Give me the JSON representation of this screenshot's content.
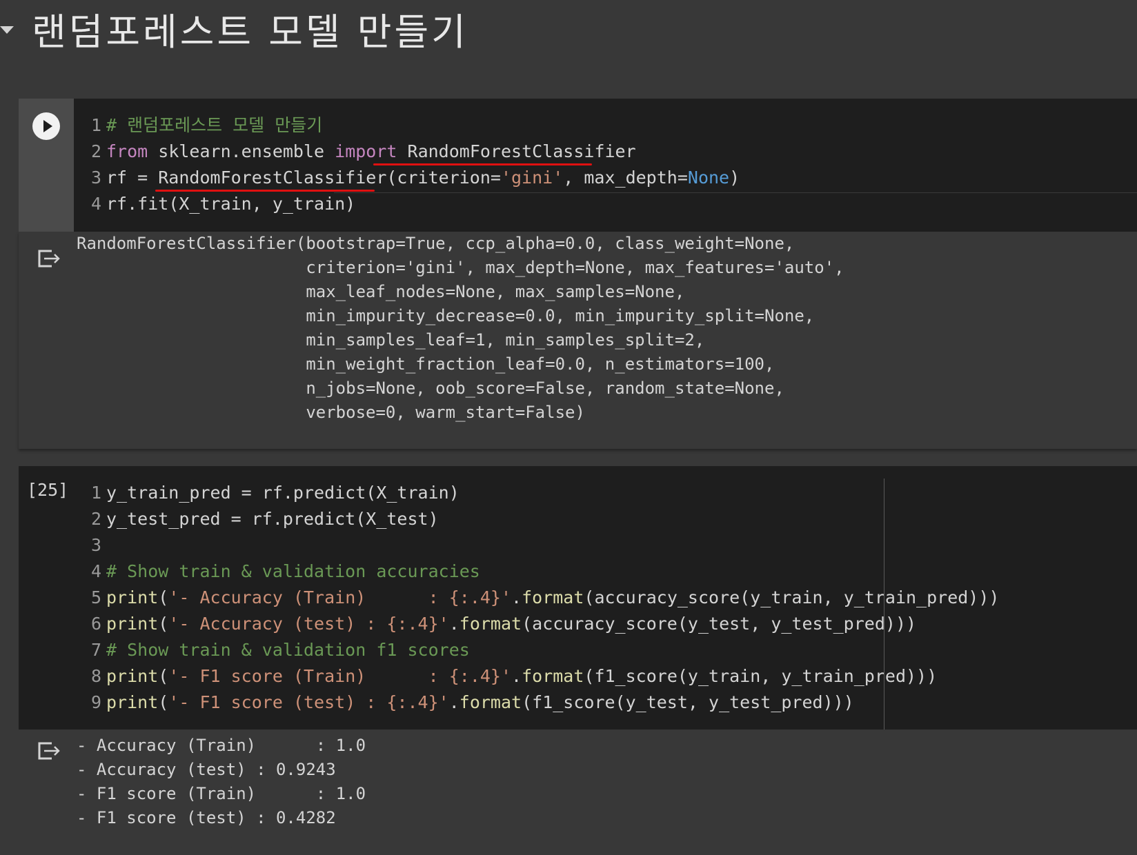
{
  "section": {
    "title": "랜덤포레스트 모델 만들기"
  },
  "cell1": {
    "lines": [
      {
        "n": "1",
        "segs": [
          {
            "t": "# 랜덤포레스트 모델 만들기",
            "c": "cm"
          }
        ]
      },
      {
        "n": "2",
        "segs": [
          {
            "t": "from",
            "c": "kw"
          },
          {
            "t": " sklearn.ensemble ",
            "c": ""
          },
          {
            "t": "import",
            "c": "kw"
          },
          {
            "t": " RandomForestClassifier",
            "c": ""
          }
        ]
      },
      {
        "n": "3",
        "segs": [
          {
            "t": "rf = RandomForestClassifier(criterion=",
            "c": ""
          },
          {
            "t": "'gini'",
            "c": "st"
          },
          {
            "t": ", max_depth=",
            "c": ""
          },
          {
            "t": "None",
            "c": "bl"
          },
          {
            "t": ")",
            "c": ""
          }
        ]
      },
      {
        "n": "4",
        "segs": [
          {
            "t": "rf.fit(X_train, y_train)",
            "c": ""
          }
        ]
      }
    ],
    "output": "RandomForestClassifier(bootstrap=True, ccp_alpha=0.0, class_weight=None,\n                       criterion='gini', max_depth=None, max_features='auto',\n                       max_leaf_nodes=None, max_samples=None,\n                       min_impurity_decrease=0.0, min_impurity_split=None,\n                       min_samples_leaf=1, min_samples_split=2,\n                       min_weight_fraction_leaf=0.0, n_estimators=100,\n                       n_jobs=None, oob_score=False, random_state=None,\n                       verbose=0, warm_start=False)"
  },
  "cell2": {
    "exec_count": "[25]",
    "lines": [
      {
        "n": "1",
        "segs": [
          {
            "t": "y_train_pred = rf.predict(X_train)",
            "c": ""
          }
        ]
      },
      {
        "n": "2",
        "segs": [
          {
            "t": "y_test_pred = rf.predict(X_test)",
            "c": ""
          }
        ]
      },
      {
        "n": "3",
        "segs": []
      },
      {
        "n": "4",
        "segs": [
          {
            "t": "# Show train & validation accuracies",
            "c": "cm"
          }
        ]
      },
      {
        "n": "5",
        "segs": [
          {
            "t": "print",
            "c": "fn"
          },
          {
            "t": "(",
            "c": ""
          },
          {
            "t": "'- Accuracy (Train)      : {:.4}'",
            "c": "st"
          },
          {
            "t": ".",
            "c": ""
          },
          {
            "t": "format",
            "c": "fn"
          },
          {
            "t": "(accuracy_score(y_train, y_train_pred)))",
            "c": ""
          }
        ]
      },
      {
        "n": "6",
        "segs": [
          {
            "t": "print",
            "c": "fn"
          },
          {
            "t": "(",
            "c": ""
          },
          {
            "t": "'- Accuracy (test) : {:.4}'",
            "c": "st"
          },
          {
            "t": ".",
            "c": ""
          },
          {
            "t": "format",
            "c": "fn"
          },
          {
            "t": "(accuracy_score(y_test, y_test_pred)))",
            "c": ""
          }
        ]
      },
      {
        "n": "7",
        "segs": [
          {
            "t": "# Show train & validation f1 scores",
            "c": "cm"
          }
        ]
      },
      {
        "n": "8",
        "segs": [
          {
            "t": "print",
            "c": "fn"
          },
          {
            "t": "(",
            "c": ""
          },
          {
            "t": "'- F1 score (Train)      : {:.4}'",
            "c": "st"
          },
          {
            "t": ".",
            "c": ""
          },
          {
            "t": "format",
            "c": "fn"
          },
          {
            "t": "(f1_score(y_train, y_train_pred)))",
            "c": ""
          }
        ]
      },
      {
        "n": "9",
        "segs": [
          {
            "t": "print",
            "c": "fn"
          },
          {
            "t": "(",
            "c": ""
          },
          {
            "t": "'- F1 score (test) : {:.4}'",
            "c": "st"
          },
          {
            "t": ".",
            "c": ""
          },
          {
            "t": "format",
            "c": "fn"
          },
          {
            "t": "(f1_score(y_test, y_test_pred)))",
            "c": ""
          }
        ]
      }
    ],
    "output": "- Accuracy (Train)      : 1.0\n- Accuracy (test) : 0.9243\n- F1 score (Train)      : 1.0\n- F1 score (test) : 0.4282"
  }
}
